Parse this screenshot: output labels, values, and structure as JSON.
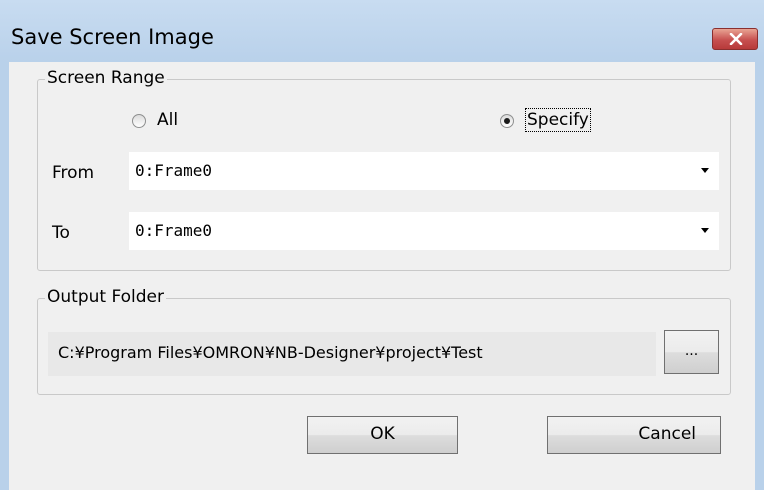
{
  "window": {
    "title": "Save Screen Image"
  },
  "screen_range": {
    "legend": "Screen Range",
    "radio_all_label": "All",
    "radio_specify_label": "Specify",
    "selected": "Specify",
    "from_label": "From",
    "from_value": "0:Frame0",
    "to_label": "To",
    "to_value": "0:Frame0"
  },
  "output_folder": {
    "legend": "Output Folder",
    "path": "C:¥Program Files¥OMRON¥NB-Designer¥project¥Test",
    "browse_label": "..."
  },
  "buttons": {
    "ok": "OK",
    "cancel": "Cancel"
  },
  "icons": {
    "close": "close-icon",
    "dropdown": "chevron-down-icon"
  },
  "colors": {
    "title_bar": "#b9d1ea",
    "close_button": "#c75050",
    "dialog_background": "#f0f0f0"
  }
}
